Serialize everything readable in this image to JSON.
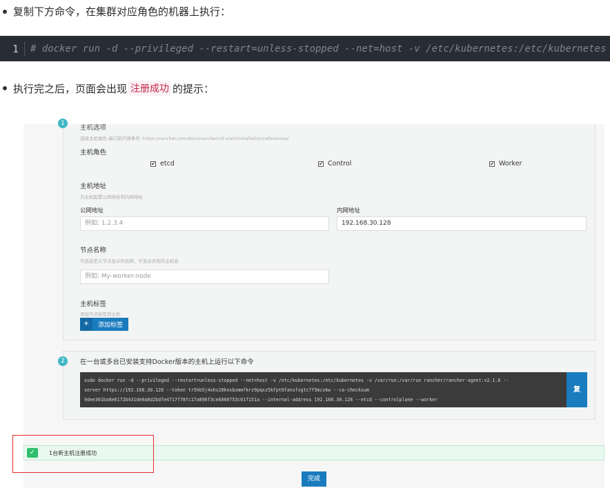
{
  "instructions": {
    "step1": "复制下方命令，在集群对应角色的机器上执行：",
    "step2_before": "执行完之后，页面会出现",
    "step2_code": "注册成功",
    "step2_after": "的提示："
  },
  "codeblock": {
    "line_number": "1",
    "command": "# docker run -d --privileged --restart=unless-stopped --net=host -v /etc/kubernetes:/etc/kubernetes"
  },
  "form": {
    "step1_number": "1",
    "roles_partial_title": "主机选项",
    "roles_hint": "选择主机角色,端口防问请参考: https://rancher.com/docs/rancher/v2.x/en/installation/references/",
    "roles_label": "主机角色",
    "roles": [
      {
        "name": "etcd",
        "checked": true
      },
      {
        "name": "Control",
        "checked": true
      },
      {
        "name": "Worker",
        "checked": true
      }
    ],
    "address_label": "主机地址",
    "address_hint": "为主机配置公网地址和内网地址",
    "public_label": "公网地址",
    "public_placeholder": "例如: 1.2.3.4",
    "private_label": "内网地址",
    "private_value": "192.168.30.128",
    "node_label": "节点名称",
    "node_hint": "可选自定义节点显示的名称，不显示实际的主机名",
    "node_placeholder": "例如: My-worker-node",
    "tags_label": "主机标签",
    "tags_hint": "添加节点标签到主机",
    "add_tag_icon": "+",
    "add_tag_label": "添加标签"
  },
  "run": {
    "step2_number": "2",
    "title": "在一台或多台已安装支持Docker版本的主机上运行以下命令",
    "command_line1": "sudo docker run -d --privileged --restart=unless-stopped --net=host -v /etc/kubernetes:/etc/kubernetes -v /var/run:/var/run rancher/rancher-agent:v2.1.6 --",
    "command_line2": "server https://192.168.30.128 --token tr5hb5j4xhx28knxbxmmfkrz9pqxz5kfpt6fansfxgtc7f5mcxkw --ca-checksum",
    "command_line3": "9dee301ba8e6172b431de0a8d2bdfe4717f78fc17a896f3ce6860753c61f151a --internal-address 192.168.30.128 --etcd --controlplane --worker",
    "copy_label": "复"
  },
  "banner": {
    "icon": "✓",
    "message": "1台新主机注册成功"
  },
  "done_label": "完成"
}
